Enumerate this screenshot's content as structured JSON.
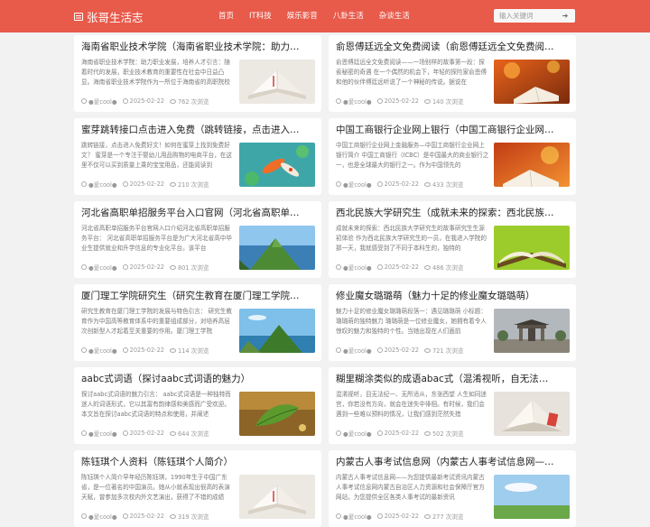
{
  "site": {
    "name": "张哥生活志"
  },
  "nav": [
    {
      "label": "首页"
    },
    {
      "label": "IT科技"
    },
    {
      "label": "娱乐影音"
    },
    {
      "label": "八卦生活"
    },
    {
      "label": "杂谈生活"
    }
  ],
  "search": {
    "placeholder": "输入关键词",
    "button_icon": "arrow-right-icon"
  },
  "articles": [
    {
      "title": "海南省职业技术学院（海南省职业技术学院：助力职业人才培养）",
      "desc": "海南省职业技术学院：助力职业发展，培养人才引言：随着时代的发展，职业技术教育的重要性在社会中日益凸显。海南省职业技术学院作为一所位于海南省的高职院校",
      "author": "●爱cool●",
      "date": "2025-02-22",
      "views": "762 次浏览",
      "thumb": "book"
    },
    {
      "title": "俞恩傅廷远全文免费阅读（俞恩傅廷远全文免费阅读）",
      "desc": "俞恩傅廷远全文免费阅读——一场别样的故事第一段：探索秘密的奇遇 在一个偶然的机会下，年轻的探险家俞恩傅和他的伙伴傅廷远听说了一个神秘的传说。据说在",
      "author": "●爱cool●",
      "date": "2025-02-22",
      "views": "140 次浏览",
      "thumb": "autumn"
    },
    {
      "title": "蜜芽跳转接口点击进入免费（跳转链接，点击进入免费）",
      "desc": "跳转链接，点击进入免费好文！如何在蜜芽上找到免费好文？ 蜜芽是一个专注于婴幼儿用品购物的电商平台，在这里不仅可以买到质量上乘的宝宝用品，还能阅读到",
      "author": "●爱cool●",
      "date": "2025-02-22",
      "views": "210 次浏览",
      "thumb": "koi"
    },
    {
      "title": "中国工商银行企业网上银行（中国工商银行企业网上银行）",
      "desc": "中国工商银行企业网上金融服务—中国工商银行企业网上银行简介 中国工商银行（ICBC）是中国最大的商业银行之一，也是全球最大的银行之一。作为中国领先的",
      "author": "●爱cool●",
      "date": "2025-02-22",
      "views": "433 次浏览",
      "thumb": "autumn2"
    },
    {
      "title": "河北省高职单招服务平台入口官网（河北省高职单招服务平台）",
      "desc": "河北省高职单招服务平台官网入口介绍河北省高职单招服务平台： 河北省高职单招服务平台是为广大河北省高中毕业生提供就业和升学信息的专业化平台。该平台",
      "author": "●爱cool●",
      "date": "2025-02-22",
      "views": "801 次浏览",
      "thumb": "mountain"
    },
    {
      "title": "西北民族大学研究生（成就未来的探索：西北民族大学研究生）",
      "desc": "成就未来的探索：西北民族大学研究生的故事研究生生源初体验 作为西北民族大学研究生的一员，在我进入学院的那一天，我就感受到了不同于本科生的，独特的",
      "author": "●爱cool●",
      "date": "2025-02-22",
      "views": "486 次浏览",
      "thumb": "openbook"
    },
    {
      "title": "厦门理工学院研究生（研究生教育在厦门理工学院的发展与特色）",
      "desc": "研究生教育在厦门理工学院的发展与特色引言： 研究生教育作为中国高等教育体系中的重要组成部分，对培养高层次创新型人才起着至关重要的作用。厦门理工学院",
      "author": "●爱cool●",
      "date": "2025-02-22",
      "views": "114 次浏览",
      "thumb": "mountain2"
    },
    {
      "title": "修业魔女璐璐萌（魅力十足的修业魔女璐璐萌）",
      "desc": "魅力十足的修业魔女璐璐萌段落一：遇见璐璐萌 小标题：璐璐萌的独特魅力 璐璐萌是一位修业魔女，她拥有着令人惊叹的魅力和独特的个性。当她出现在人们面前",
      "author": "●爱cool●",
      "date": "2025-02-22",
      "views": "721 次浏览",
      "thumb": "gate"
    },
    {
      "title": "aabc式词语（探讨aabc式词语的魅力）",
      "desc": "探讨aabc式词语的魅力引言： aabc式词语是一种独特而迷人的词语形式，它以其富有韵律感和美感而广受欢迎。本文旨在探讨aabc式词语的特点和使用，并阐述",
      "author": "●爱cool●",
      "date": "2025-02-22",
      "views": "644 次浏览",
      "thumb": "leaf"
    },
    {
      "title": "糊里糊涂类似的成语abac式（混淆视听，自无法纪）",
      "desc": "混淆视听，目无法纪一、无所适从，东张西望 人生如同迷宫，你若没有方向，就会在迷失中徘徊。有时候，我们会遇到一些难以预料的情况，让我们感到茫然失措",
      "author": "●爱cool●",
      "date": "2025-02-22",
      "views": "502 次浏览",
      "thumb": "pages"
    },
    {
      "title": "陈钰琪个人资料（陈钰琪个人简介）",
      "desc": "陈钰琪个人简介早年经历陈钰琪，1990年生于中国广东省，是一位著名的中国演员。她从小就表现出很高的表演天赋，曾参加多次校内外文艺演出，获得了不错的成绩",
      "author": "●爱cool●",
      "date": "2025-02-22",
      "views": "319 次浏览",
      "thumb": "book"
    },
    {
      "title": "内蒙古人事考试信息网（内蒙古人事考试信息网——为人才选拔提供保障）",
      "desc": "内蒙古人事考试信息网——为您提供最新考试资讯内蒙古人事考试信息网内蒙古自治区人力资源和社会保障厅官方网站，为您提供全区各类人事考试的最新资讯",
      "author": "●爱cool●",
      "date": "2025-02-22",
      "views": "277 次浏览",
      "thumb": "sky"
    }
  ]
}
